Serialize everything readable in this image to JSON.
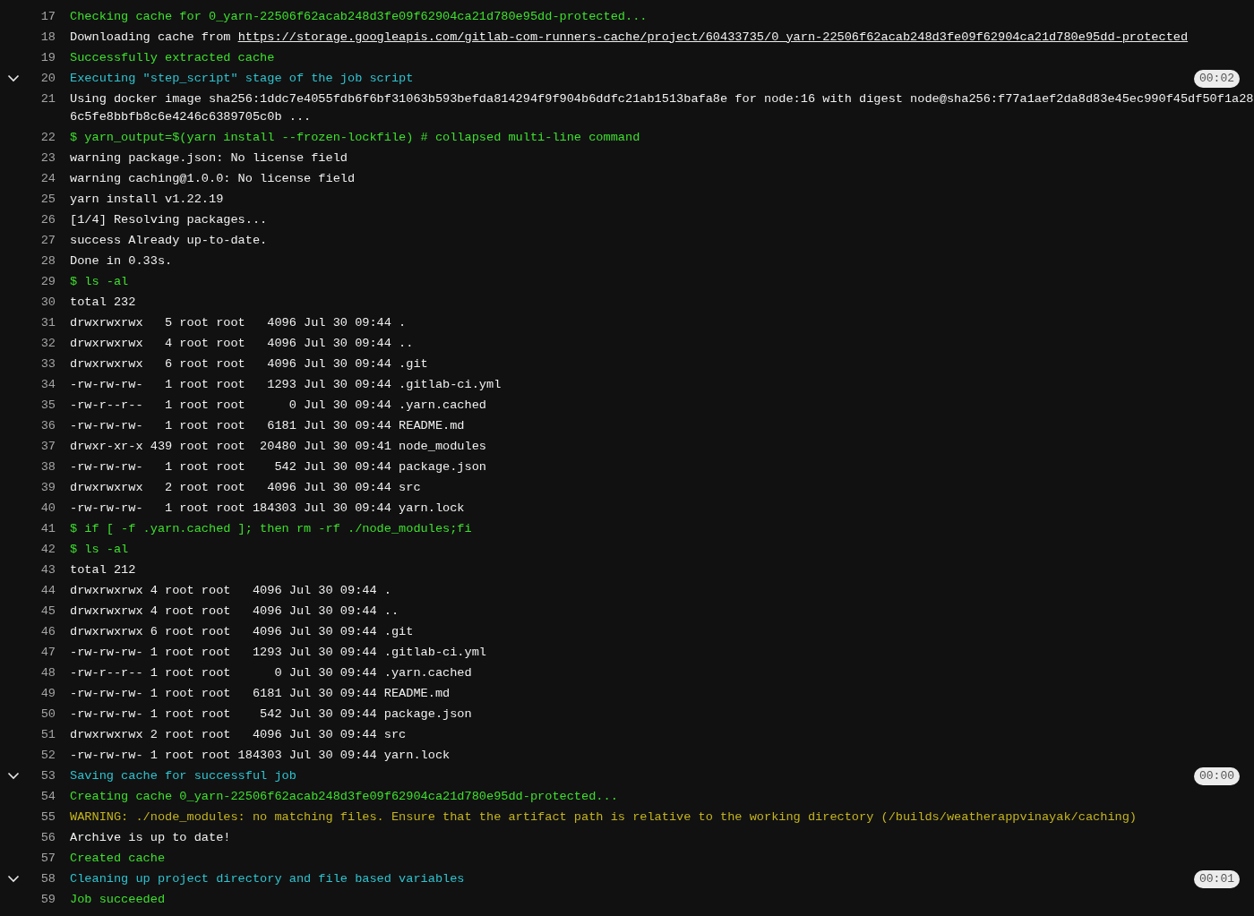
{
  "log_lines": [
    {
      "number": "17",
      "kind": "success",
      "text": "Checking cache for 0_yarn-22506f62acab248d3fe09f62904ca21d780e95dd-protected..."
    },
    {
      "number": "18",
      "kind": "plain",
      "text": "Downloading cache from ",
      "link": "https://storage.googleapis.com/gitlab-com-runners-cache/project/60433735/0_yarn-22506f62acab248d3fe09f62904ca21d780e95dd-protected"
    },
    {
      "number": "19",
      "kind": "success",
      "text": "Successfully extracted cache"
    },
    {
      "number": "20",
      "kind": "section",
      "text": "Executing \"step_script\" stage of the job script",
      "expanded": true,
      "duration": "00:02"
    },
    {
      "number": "21",
      "kind": "plain",
      "text": "Using docker image sha256:1ddc7e4055fdb6f6bf31063b593befda814294f9f904b6ddfc21ab1513bafa8e for node:16 with digest node@sha256:f77a1aef2da8d83e45ec990f45df50f1a286c5fe8bbfb8c6e4246c6389705c0b ..."
    },
    {
      "number": "22",
      "kind": "success",
      "text": "$ yarn_output=$(yarn install --frozen-lockfile) # collapsed multi-line command"
    },
    {
      "number": "23",
      "kind": "plain",
      "text": "warning package.json: No license field"
    },
    {
      "number": "24",
      "kind": "plain",
      "text": "warning caching@1.0.0: No license field"
    },
    {
      "number": "25",
      "kind": "plain",
      "text": "yarn install v1.22.19"
    },
    {
      "number": "26",
      "kind": "plain",
      "text": "[1/4] Resolving packages..."
    },
    {
      "number": "27",
      "kind": "plain",
      "text": "success Already up-to-date."
    },
    {
      "number": "28",
      "kind": "plain",
      "text": "Done in 0.33s."
    },
    {
      "number": "29",
      "kind": "success",
      "text": "$ ls -al"
    },
    {
      "number": "30",
      "kind": "plain",
      "text": "total 232"
    },
    {
      "number": "31",
      "kind": "plain",
      "text": "drwxrwxrwx   5 root root   4096 Jul 30 09:44 ."
    },
    {
      "number": "32",
      "kind": "plain",
      "text": "drwxrwxrwx   4 root root   4096 Jul 30 09:44 .."
    },
    {
      "number": "33",
      "kind": "plain",
      "text": "drwxrwxrwx   6 root root   4096 Jul 30 09:44 .git"
    },
    {
      "number": "34",
      "kind": "plain",
      "text": "-rw-rw-rw-   1 root root   1293 Jul 30 09:44 .gitlab-ci.yml"
    },
    {
      "number": "35",
      "kind": "plain",
      "text": "-rw-r--r--   1 root root      0 Jul 30 09:44 .yarn.cached"
    },
    {
      "number": "36",
      "kind": "plain",
      "text": "-rw-rw-rw-   1 root root   6181 Jul 30 09:44 README.md"
    },
    {
      "number": "37",
      "kind": "plain",
      "text": "drwxr-xr-x 439 root root  20480 Jul 30 09:41 node_modules"
    },
    {
      "number": "38",
      "kind": "plain",
      "text": "-rw-rw-rw-   1 root root    542 Jul 30 09:44 package.json"
    },
    {
      "number": "39",
      "kind": "plain",
      "text": "drwxrwxrwx   2 root root   4096 Jul 30 09:44 src"
    },
    {
      "number": "40",
      "kind": "plain",
      "text": "-rw-rw-rw-   1 root root 184303 Jul 30 09:44 yarn.lock"
    },
    {
      "number": "41",
      "kind": "success",
      "text": "$ if [ -f .yarn.cached ]; then rm -rf ./node_modules;fi"
    },
    {
      "number": "42",
      "kind": "success",
      "text": "$ ls -al"
    },
    {
      "number": "43",
      "kind": "plain",
      "text": "total 212"
    },
    {
      "number": "44",
      "kind": "plain",
      "text": "drwxrwxrwx 4 root root   4096 Jul 30 09:44 ."
    },
    {
      "number": "45",
      "kind": "plain",
      "text": "drwxrwxrwx 4 root root   4096 Jul 30 09:44 .."
    },
    {
      "number": "46",
      "kind": "plain",
      "text": "drwxrwxrwx 6 root root   4096 Jul 30 09:44 .git"
    },
    {
      "number": "47",
      "kind": "plain",
      "text": "-rw-rw-rw- 1 root root   1293 Jul 30 09:44 .gitlab-ci.yml"
    },
    {
      "number": "48",
      "kind": "plain",
      "text": "-rw-r--r-- 1 root root      0 Jul 30 09:44 .yarn.cached"
    },
    {
      "number": "49",
      "kind": "plain",
      "text": "-rw-rw-rw- 1 root root   6181 Jul 30 09:44 README.md"
    },
    {
      "number": "50",
      "kind": "plain",
      "text": "-rw-rw-rw- 1 root root    542 Jul 30 09:44 package.json"
    },
    {
      "number": "51",
      "kind": "plain",
      "text": "drwxrwxrwx 2 root root   4096 Jul 30 09:44 src"
    },
    {
      "number": "52",
      "kind": "plain",
      "text": "-rw-rw-rw- 1 root root 184303 Jul 30 09:44 yarn.lock"
    },
    {
      "number": "53",
      "kind": "section",
      "text": "Saving cache for successful job",
      "expanded": true,
      "duration": "00:00"
    },
    {
      "number": "54",
      "kind": "success",
      "text": "Creating cache 0_yarn-22506f62acab248d3fe09f62904ca21d780e95dd-protected..."
    },
    {
      "number": "55",
      "kind": "warning",
      "text": "WARNING: ./node_modules: no matching files. Ensure that the artifact path is relative to the working directory (/builds/weatherappvinayak/caching)"
    },
    {
      "number": "56",
      "kind": "plain",
      "text": "Archive is up to date!"
    },
    {
      "number": "57",
      "kind": "success",
      "text": "Created cache"
    },
    {
      "number": "58",
      "kind": "section",
      "text": "Cleaning up project directory and file based variables",
      "expanded": true,
      "duration": "00:01"
    },
    {
      "number": "59",
      "kind": "success",
      "text": "Job succeeded"
    }
  ]
}
